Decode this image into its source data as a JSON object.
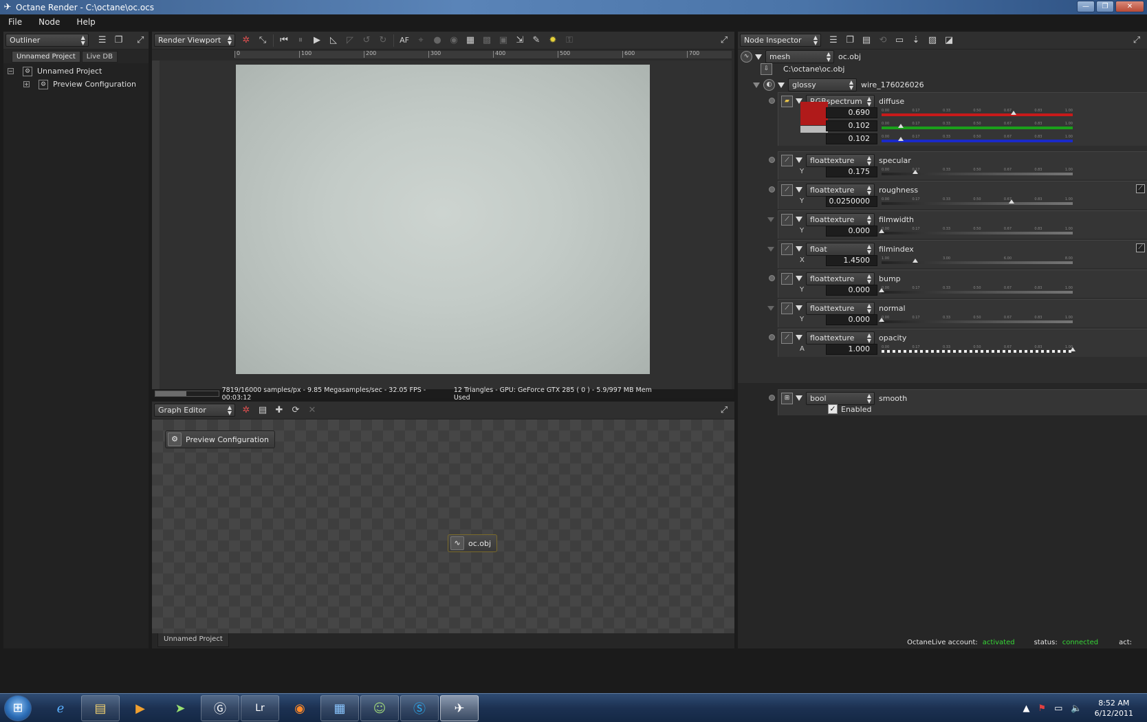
{
  "window": {
    "title": "Octane Render - C:\\octane\\oc.ocs"
  },
  "menubar": {
    "items": [
      "File",
      "Node",
      "Help"
    ]
  },
  "outliner": {
    "panel_label": "Outliner",
    "tabs": [
      "Unnamed Project",
      "Live DB"
    ],
    "tree": [
      {
        "label": "Unnamed Project",
        "expander": "−"
      },
      {
        "label": "Preview Configuration",
        "expander": "+"
      }
    ]
  },
  "viewport": {
    "panel_label": "Render Viewport",
    "af_label": "AF",
    "ruler_ticks": [
      "0",
      "100",
      "200",
      "300",
      "400",
      "500",
      "600",
      "700"
    ],
    "progress": 0.489,
    "status_left": "7819/16000 samples/px - 9.85 Megasamples/sec - 32.05 FPS - 00:03:12",
    "status_right": "12 Triangles - GPU: GeForce GTX 285 ( 0 ) - 5.9/997 MB Mem Used"
  },
  "graph_editor": {
    "panel_label": "Graph Editor",
    "nodes": [
      {
        "label": "Preview Configuration"
      },
      {
        "label": "oc.obj"
      }
    ],
    "bottom_tab": "Unnamed Project"
  },
  "inspector": {
    "panel_label": "Node Inspector",
    "mesh": {
      "type": "mesh",
      "name": "oc.obj",
      "path": "C:\\octane\\oc.obj"
    },
    "material": {
      "type": "glossy",
      "name": "wire_176026026"
    },
    "slider_ticks": [
      "0.00",
      "0.17",
      "0.33",
      "0.50",
      "0.67",
      "0.83",
      "1.00"
    ],
    "index_ticks": [
      "1.00",
      "",
      "3.00",
      "",
      "6.00",
      "",
      "8.00"
    ],
    "diffuse": {
      "type": "RGBspectrum",
      "name": "diffuse",
      "r": "0.690",
      "g": "0.102",
      "b": "0.102",
      "r_val": 0.69,
      "g_val": 0.102,
      "b_val": 0.102,
      "swatch_color": "#b01a1a"
    },
    "params": [
      {
        "type": "floattexture",
        "name": "specular",
        "axis": "Y",
        "value": "0.175",
        "fraction": 0.175
      },
      {
        "type": "floattexture",
        "name": "roughness",
        "axis": "Y",
        "value": "0.0250000",
        "fraction": 0.68
      },
      {
        "type": "floattexture",
        "name": "filmwidth",
        "axis": "Y",
        "value": "0.000",
        "fraction": 0.0
      },
      {
        "type": "float",
        "name": "filmindex",
        "axis": "X",
        "value": "1.4500",
        "fraction": 0.175
      },
      {
        "type": "floattexture",
        "name": "bump",
        "axis": "Y",
        "value": "0.000",
        "fraction": 0.0
      },
      {
        "type": "floattexture",
        "name": "normal",
        "axis": "Y",
        "value": "0.000",
        "fraction": 0.0
      },
      {
        "type": "floattexture",
        "name": "opacity",
        "axis": "A",
        "value": "1.000",
        "fraction": 1.0
      }
    ],
    "smooth": {
      "type": "bool",
      "name": "smooth",
      "label": "Enabled",
      "checked": true
    }
  },
  "octanelive": {
    "account_label": "OctaneLive account:",
    "account_value": "activated",
    "status_label": "status:",
    "status_value": "connected",
    "act_label": "act:"
  },
  "taskbar": {
    "clock_time": "8:52 AM",
    "clock_date": "6/12/2011",
    "lr_label": "Lr"
  }
}
